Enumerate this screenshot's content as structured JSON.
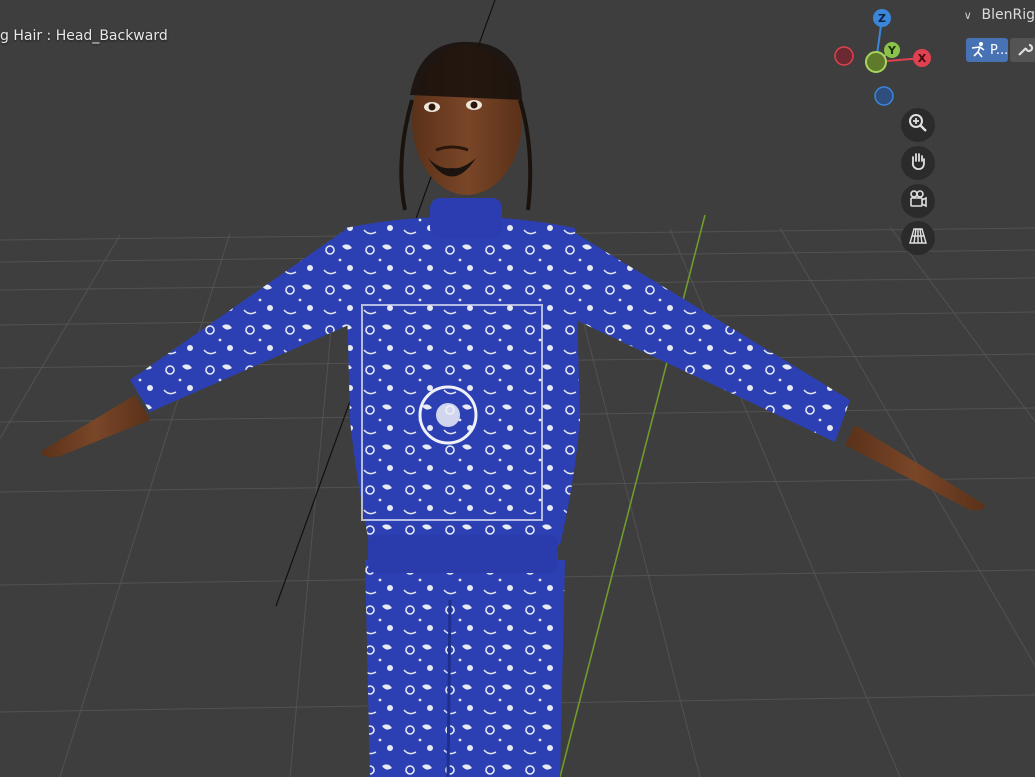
{
  "viewport": {
    "overlay_text": "g Hair : Head_Backward"
  },
  "sidebar": {
    "panel_title": "BlenRig",
    "tabs": [
      {
        "label": "P...",
        "icon": "armature-pose-icon",
        "active": true
      },
      {
        "label": "",
        "icon": "wrench-icon",
        "active": false
      }
    ]
  },
  "gizmo": {
    "axes": {
      "x": "X",
      "y": "Y",
      "z": "Z"
    },
    "colors": {
      "x": "#e0414f",
      "y": "#8bc34a",
      "z": "#3b86d9"
    }
  },
  "nav_buttons": [
    {
      "icon": "zoom-icon"
    },
    {
      "icon": "hand-pan-icon"
    },
    {
      "icon": "camera-view-icon"
    },
    {
      "icon": "perspective-grid-icon"
    }
  ],
  "colors": {
    "viewport_bg": "#3e3e3e",
    "grid_line": "#555555",
    "accent_tab": "#4772b3",
    "outfit_blue": "#2a3fb0",
    "pattern_white": "#e8ecf5",
    "skin": "#6b3d24"
  }
}
